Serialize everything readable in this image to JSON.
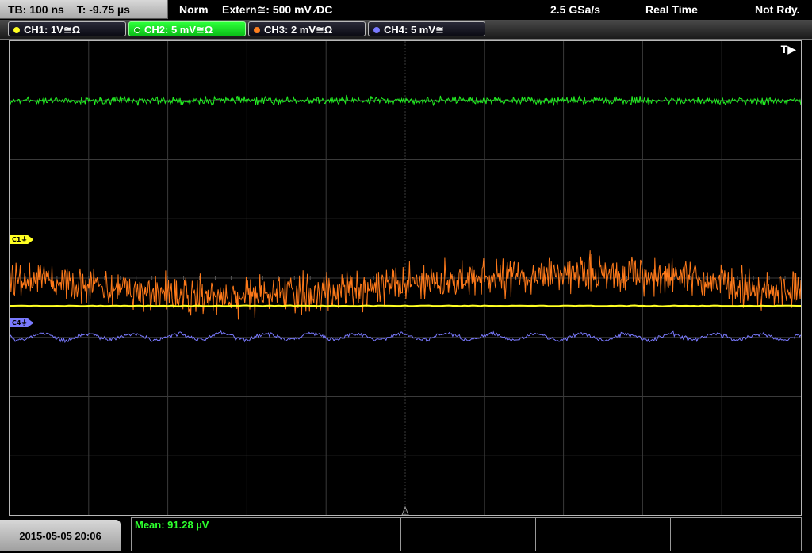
{
  "timebase": {
    "tb": "TB: 100 ns",
    "trigger_pos": "T: -9.75 µs"
  },
  "status": {
    "mode": "Norm",
    "trigger_source": "Extern≅: 500 mV ∕DC",
    "sample_rate": "2.5 GSa/s",
    "acquisition": "Real Time",
    "state": "Not Rdy."
  },
  "channels": [
    {
      "label": "CH1: 1V≅Ω",
      "color": "#ffff22",
      "active": false
    },
    {
      "label": "CH2: 5 mV≅Ω",
      "color": "#1ed01e",
      "active": true
    },
    {
      "label": "CH3: 2 mV≅Ω",
      "color": "#ff7f1e",
      "active": false
    },
    {
      "label": "CH4: 5 mV≅",
      "color": "#7a7aff",
      "active": false
    }
  ],
  "markers": {
    "c1": "C1⏚",
    "c4": "C4⏚"
  },
  "trigger_indicator": "T▶",
  "datetime": "2015-05-05 20:06",
  "measurement": {
    "mean": "Mean: 91.28 µV"
  },
  "colors": {
    "ch1": "#ffff22",
    "ch2": "#22ee22",
    "ch3": "#ff7a1a",
    "ch4": "#7a7aff",
    "grid": "#3a3a3a"
  }
}
